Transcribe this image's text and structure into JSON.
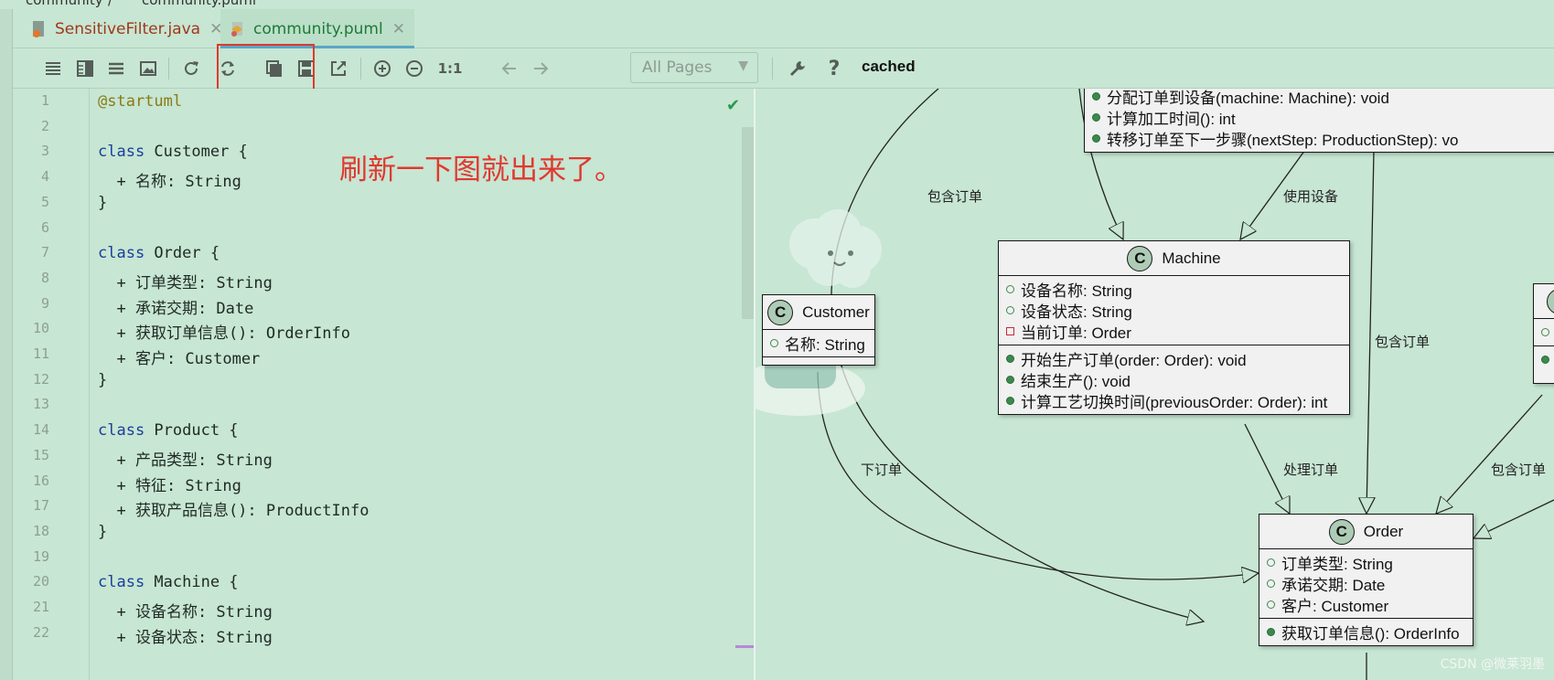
{
  "breadcrumb": {
    "project": "community",
    "file": "community.puml"
  },
  "tabs": [
    {
      "label": "SensitiveFilter.java",
      "active": false
    },
    {
      "label": "community.puml",
      "active": true
    }
  ],
  "toolbar": {
    "pages_select": "All Pages",
    "zoom_reset": "1:1",
    "help": "?",
    "status": "cached"
  },
  "editor": {
    "line_numbers": [
      "1",
      "2",
      "3",
      "4",
      "5",
      "6",
      "7",
      "8",
      "9",
      "10",
      "11",
      "12",
      "13",
      "14",
      "15",
      "16",
      "17",
      "18",
      "19",
      "20",
      "21",
      "22"
    ],
    "lines": [
      "@startuml",
      "",
      "class Customer {",
      "  + 名称: String",
      "}",
      "",
      "class Order {",
      "  + 订单类型: String",
      "  + 承诺交期: Date",
      "  + 获取订单信息(): OrderInfo",
      "  + 客户: Customer",
      "}",
      "",
      "class Product {",
      "  + 产品类型: String",
      "  + 特征: String",
      "  + 获取产品信息(): ProductInfo",
      "}",
      "",
      "class Machine {",
      "  + 设备名称: String",
      "  + 设备状态: String"
    ],
    "annotation": "刷新一下图就出来了。"
  },
  "diagram": {
    "top_partial_methods": [
      "分配订单到设备(machine: Machine): void",
      "计算加工时间(): int",
      "转移订单至下一步骤(nextStep: ProductionStep): vo"
    ],
    "customer": {
      "name": "Customer",
      "icon": "C",
      "fields": [
        "名称: String"
      ]
    },
    "machine": {
      "name": "Machine",
      "icon": "C",
      "fields": [
        "设备名称: String",
        "设备状态: String",
        "当前订单: Order"
      ],
      "methods": [
        "开始生产订单(order: Order): void",
        "结束生产(): void",
        "计算工艺切换时间(previousOrder: Order): int"
      ]
    },
    "order": {
      "name": "Order",
      "icon": "C",
      "fields": [
        "订单类型: String",
        "承诺交期: Date",
        "客户: Customer"
      ],
      "methods": [
        "获取订单信息(): OrderInfo"
      ]
    },
    "edge_labels": {
      "contains_order_1": "包含订单",
      "use_device": "使用设备",
      "contains_order_2": "包含订单",
      "place_order": "下订单",
      "process_order": "处理订单",
      "contains_order_3": "包含订单"
    },
    "watermark": "CSDN @微莱羽墨"
  },
  "colors": {
    "background": "#c7e6d3",
    "annotation_red": "#e0392f",
    "class_fill": "#f1f1f1"
  }
}
